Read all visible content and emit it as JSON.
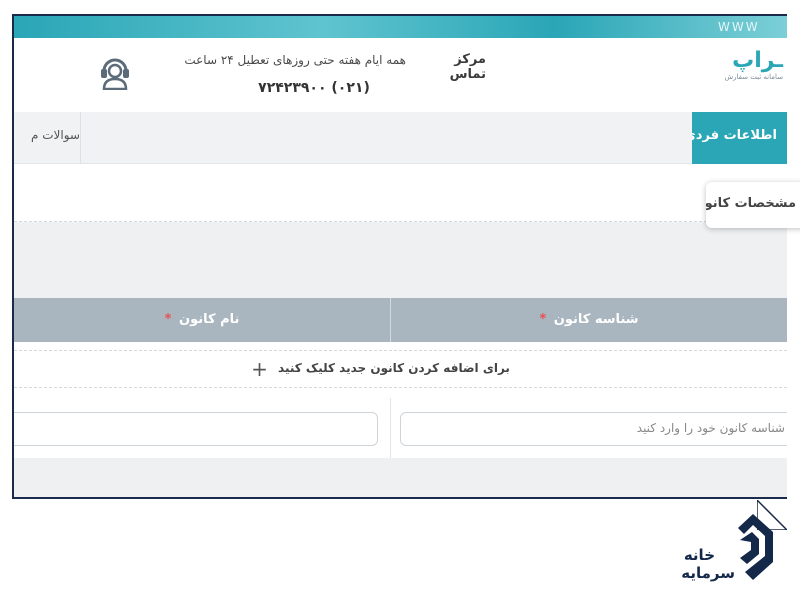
{
  "header": {
    "www": "WWW",
    "logo_main": "ـراپ",
    "logo_sub": "سامانه ثبت سفارش",
    "contact_title": "مرکز تماس",
    "contact_hours": "همه ایام هفته حتی روزهای تعطیل ۲۴ ساعت",
    "contact_phone": "(۰۲۱) ۷۲۴۲۳۹۰۰"
  },
  "nav": {
    "active_tab": "اطلاعات فردی",
    "faq_tab": "سوالات م"
  },
  "section": {
    "card_title": "مشخصات کانون"
  },
  "table": {
    "col_id": "شناسه کانون",
    "col_name": "نام کانون",
    "required_mark": "*",
    "add_label": "برای اضافه کردن کانون جدید کلیک کنید",
    "id_placeholder": "شناسه کانون خود را وارد کنید",
    "name_placeholder": ""
  },
  "brand": {
    "line1": "خانه",
    "line2": "سرمایه"
  },
  "colors": {
    "accent": "#2aa6b6",
    "table_header": "#aab6bf",
    "required": "#e85151",
    "brand": "#14284a"
  }
}
